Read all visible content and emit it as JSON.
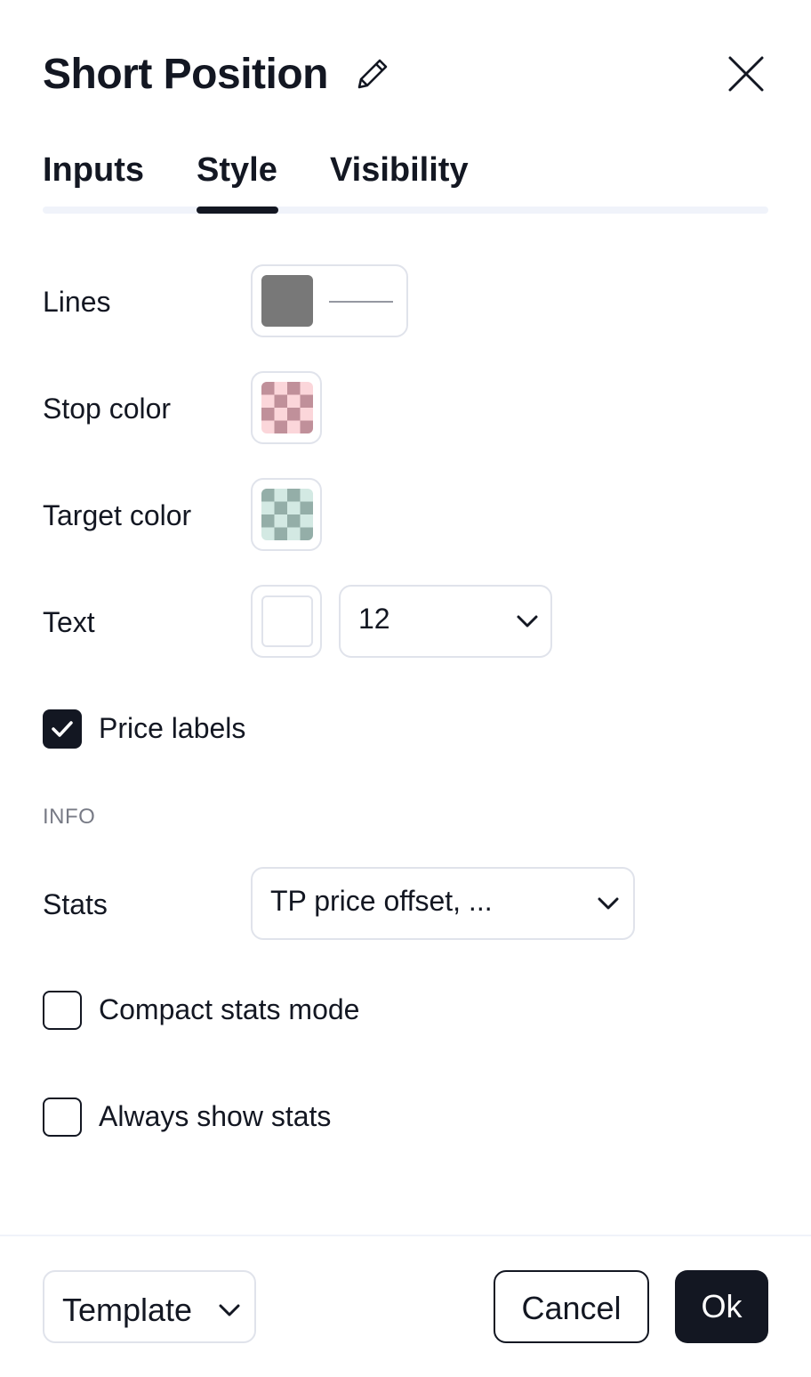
{
  "dialog": {
    "title": "Short Position",
    "edit_icon": "pencil-icon",
    "close_icon": "close-icon"
  },
  "tabs": [
    {
      "label": "Inputs",
      "active": false
    },
    {
      "label": "Style",
      "active": true
    },
    {
      "label": "Visibility",
      "active": false
    }
  ],
  "style": {
    "lines": {
      "label": "Lines",
      "color": "#787878"
    },
    "stop_color": {
      "label": "Stop color",
      "color": "#f7525f",
      "checker_light": "#fbd6da",
      "checker_dark": "#c0909a"
    },
    "target_color": {
      "label": "Target color",
      "color": "#22ab94",
      "checker_light": "#d3e9e3",
      "checker_dark": "#94aea8"
    },
    "text": {
      "label": "Text",
      "color": "#ffffff",
      "font_size": "12"
    },
    "price_labels": {
      "label": "Price labels",
      "checked": true
    }
  },
  "info": {
    "section_label": "INFO",
    "stats": {
      "label": "Stats",
      "value": "TP price offset, ..."
    },
    "compact_stats_mode": {
      "label": "Compact stats mode",
      "checked": false
    },
    "always_show_stats": {
      "label": "Always show stats",
      "checked": false
    }
  },
  "footer": {
    "template_label": "Template",
    "cancel_label": "Cancel",
    "ok_label": "Ok"
  },
  "colors": {
    "accent": "#131722",
    "border": "#e0e3eb",
    "muted": "#787b86"
  }
}
